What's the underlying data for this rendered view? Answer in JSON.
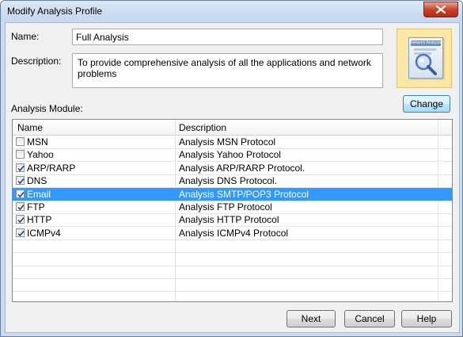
{
  "window": {
    "title": "Modify Analysis Profile"
  },
  "form": {
    "name_label": "Name:",
    "name_value": "Full Analysis",
    "description_label": "Description:",
    "description_value": "To provide comprehensive analysis of all the applications and network problems"
  },
  "logo": {
    "caption": "Network Analysis"
  },
  "buttons": {
    "change": "Change",
    "next": "Next",
    "cancel": "Cancel",
    "help": "Help"
  },
  "module": {
    "label": "Analysis Module:",
    "columns": [
      "Name",
      "Description"
    ],
    "rows": [
      {
        "name": "MSN",
        "description": "Analysis MSN Protocol",
        "checked": false,
        "selected": false
      },
      {
        "name": "Yahoo",
        "description": "Analysis Yahoo Protocol",
        "checked": false,
        "selected": false
      },
      {
        "name": "ARP/RARP",
        "description": "Analysis ARP/RARP Protocol.",
        "checked": true,
        "selected": false
      },
      {
        "name": "DNS",
        "description": "Analysis DNS Protocol.",
        "checked": true,
        "selected": false
      },
      {
        "name": "Email",
        "description": "Analysis SMTP/POP3 Protocol",
        "checked": true,
        "selected": true
      },
      {
        "name": "FTP",
        "description": "Analysis FTP Protocol",
        "checked": true,
        "selected": false
      },
      {
        "name": "HTTP",
        "description": "Analysis HTTP Protocol",
        "checked": true,
        "selected": false
      },
      {
        "name": "ICMPv4",
        "description": "Analysis ICMPv4 Protocol",
        "checked": true,
        "selected": false
      }
    ]
  },
  "colors": {
    "selection": "#3399ff",
    "logo_background": "#fbe8a6"
  },
  "icons": {
    "close": "close-icon",
    "logo": "network-analysis-magnifier-icon",
    "check": "checkmark-icon"
  }
}
